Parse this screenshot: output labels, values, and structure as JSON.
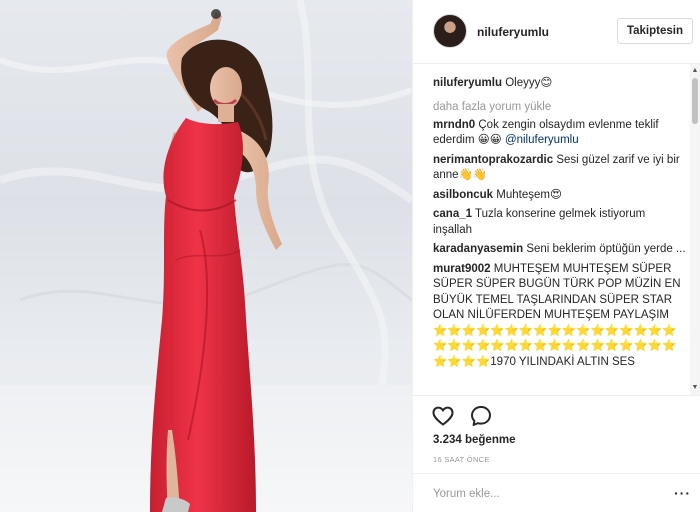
{
  "post": {
    "username": "niluferyumlu",
    "follow_label": "Takiptesin",
    "caption": "Oleyyy😊",
    "load_more": "daha fazla yorum yükle",
    "comments": [
      {
        "user": "mrndn0",
        "text": "Çok zengin olsaydım evlenme teklif ederdim 😀😀",
        "mention": "@niluferyumlu"
      },
      {
        "user": "nerimantoprakozardic",
        "text": "Sesi güzel zarif ve iyi bir anne👋👋"
      },
      {
        "user": "asilboncuk",
        "text": "Muhteşem😍"
      },
      {
        "user": "cana_1",
        "text": "Tuzla konserine gelmek istiyorum inşallah"
      },
      {
        "user": "karadanyasemin",
        "text": "Seni beklerim öptüğün yerde ..."
      },
      {
        "user": "murat9002",
        "text": "MUHTEŞEM MUHTEŞEM SÜPER SÜPER SÜPER BUGÜN TÜRK POP MÜZİN EN BÜYÜK TEMEL TAŞLARINDAN SÜPER STAR OLAN NİLÜFERDEN MUHTEŞEM PAYLAŞIM ⭐⭐⭐⭐⭐⭐⭐⭐⭐⭐⭐⭐⭐⭐⭐⭐⭐⭐⭐⭐⭐⭐⭐⭐⭐⭐⭐⭐⭐⭐⭐⭐⭐⭐⭐⭐⭐⭐1970 YILINDAKİ ALTIN SES"
      }
    ],
    "likes": "3.234 beğenme",
    "time": "16 SAAT ÖNCE",
    "comment_placeholder": "Yorum ekle...",
    "options_label": "···"
  },
  "icons": {
    "like": "heart-outline-icon",
    "comment": "speech-bubble-icon",
    "options": "more-options-icon"
  },
  "colors": {
    "dress": "#e8283a",
    "background": "#e3e6eb",
    "link": "#003569",
    "muted": "#999999"
  }
}
